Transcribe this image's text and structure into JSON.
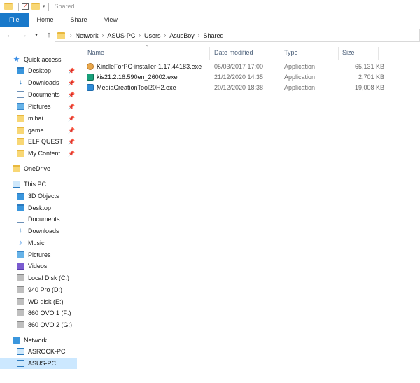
{
  "window": {
    "title": "Shared"
  },
  "ribbon": {
    "tabs": [
      "File",
      "Home",
      "Share",
      "View"
    ]
  },
  "address": {
    "crumbs": [
      "Network",
      "ASUS-PC",
      "Users",
      "AsusBoy",
      "Shared"
    ]
  },
  "nav": {
    "quick_access": {
      "label": "Quick access",
      "items": [
        {
          "label": "Desktop",
          "pinned": true
        },
        {
          "label": "Downloads",
          "pinned": true
        },
        {
          "label": "Documents",
          "pinned": true
        },
        {
          "label": "Pictures",
          "pinned": true
        },
        {
          "label": "mihai",
          "pinned": true
        },
        {
          "label": "game",
          "pinned": true
        },
        {
          "label": "ELF QUEST",
          "pinned": true
        },
        {
          "label": "My Content",
          "pinned": true
        }
      ]
    },
    "onedrive": "OneDrive",
    "this_pc": {
      "label": "This PC",
      "items": [
        "3D Objects",
        "Desktop",
        "Documents",
        "Downloads",
        "Music",
        "Pictures",
        "Videos",
        "Local Disk (C:)",
        "940 Pro (D:)",
        "WD disk (E:)",
        "860 QVO 1 (F:)",
        "860 QVO 2 (G:)"
      ]
    },
    "network": {
      "label": "Network",
      "items": [
        "ASROCK-PC",
        "ASUS-PC"
      ]
    }
  },
  "list": {
    "columns": [
      "Name",
      "Date modified",
      "Type",
      "Size"
    ],
    "rows": [
      {
        "name": "KindleForPC-installer-1.17.44183.exe",
        "date": "05/03/2017 17:00",
        "type": "Application",
        "size": "65,131 KB"
      },
      {
        "name": "kis21.2.16.590en_26002.exe",
        "date": "21/12/2020 14:35",
        "type": "Application",
        "size": "2,701 KB"
      },
      {
        "name": "MediaCreationTool20H2.exe",
        "date": "20/12/2020 18:38",
        "type": "Application",
        "size": "19,008 KB"
      }
    ]
  }
}
